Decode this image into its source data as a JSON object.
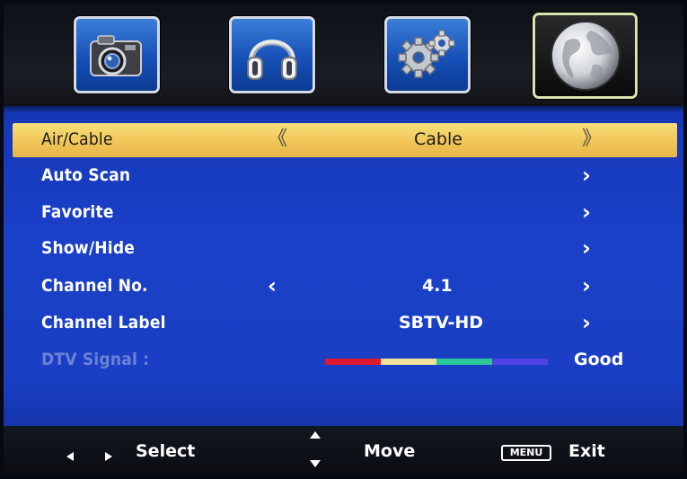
{
  "top_menu": {
    "tiles": [
      {
        "icon": "camera-icon",
        "name": "picture"
      },
      {
        "icon": "headphones-icon",
        "name": "sound"
      },
      {
        "icon": "gears-icon",
        "name": "setup"
      },
      {
        "icon": "globe-icon",
        "name": "channel",
        "selected": true
      }
    ]
  },
  "menu": {
    "rows": [
      {
        "label": "Air/Cable",
        "value": "Cable",
        "left_arrow": "《",
        "right_arrow": "》",
        "highlighted": true
      },
      {
        "label": "Auto Scan",
        "right_arrow": "›"
      },
      {
        "label": "Favorite",
        "right_arrow": "›"
      },
      {
        "label": "Show/Hide",
        "right_arrow": "›"
      },
      {
        "label": "Channel No.",
        "value": "4.1",
        "left_arrow": "‹",
        "right_arrow": "›"
      },
      {
        "label": "Channel Label",
        "value": "SBTV-HD",
        "right_arrow": "›"
      },
      {
        "label": "DTV Signal :",
        "signal_text": "Good",
        "disabled": true
      }
    ],
    "signal_colors": [
      "#e0192e",
      "#efe39a",
      "#2cc89a",
      "#5244e4"
    ]
  },
  "footer": {
    "select_label": "Select",
    "move_label": "Move",
    "menu_badge": "MENU",
    "exit_label": "Exit"
  },
  "colors": {
    "panel_blue": "#1a3fc4",
    "highlight_yellow": "#f2c85a",
    "dim_text": "#6d82d6"
  }
}
